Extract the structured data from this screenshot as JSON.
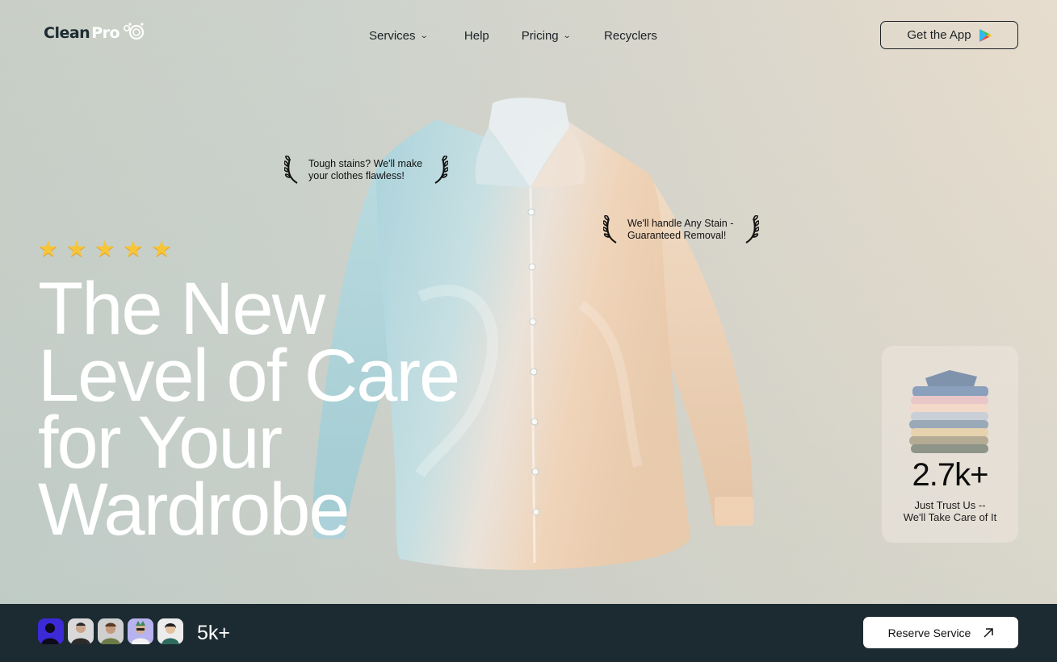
{
  "header": {
    "logo_part1": "Clean",
    "logo_part2": "Pro",
    "nav": [
      {
        "label": "Services",
        "has_dropdown": true
      },
      {
        "label": "Help",
        "has_dropdown": false
      },
      {
        "label": "Pricing",
        "has_dropdown": true
      },
      {
        "label": "Recyclers",
        "has_dropdown": false
      }
    ],
    "get_app_label": "Get the App",
    "get_app_icon": "google-play-icon"
  },
  "hero": {
    "rating_stars": 5,
    "headline": [
      "The New",
      "Level of Care",
      "for Your",
      "Wardrobe"
    ],
    "badge1": [
      "Tough stains? We'll make",
      "your clothes flawless!"
    ],
    "badge2": [
      "We'll handle Any Stain -",
      "Guaranteed Removal!"
    ]
  },
  "stats": {
    "value": "2.7k+",
    "caption": [
      "Just Trust Us --",
      "We'll Take Care of It"
    ]
  },
  "footer_bar": {
    "customer_count": "5k+",
    "reserve_label": "Reserve Service"
  },
  "colors": {
    "accent_dark": "#1c2a31",
    "star": "#f6c53a",
    "headline": "#ffffff"
  }
}
